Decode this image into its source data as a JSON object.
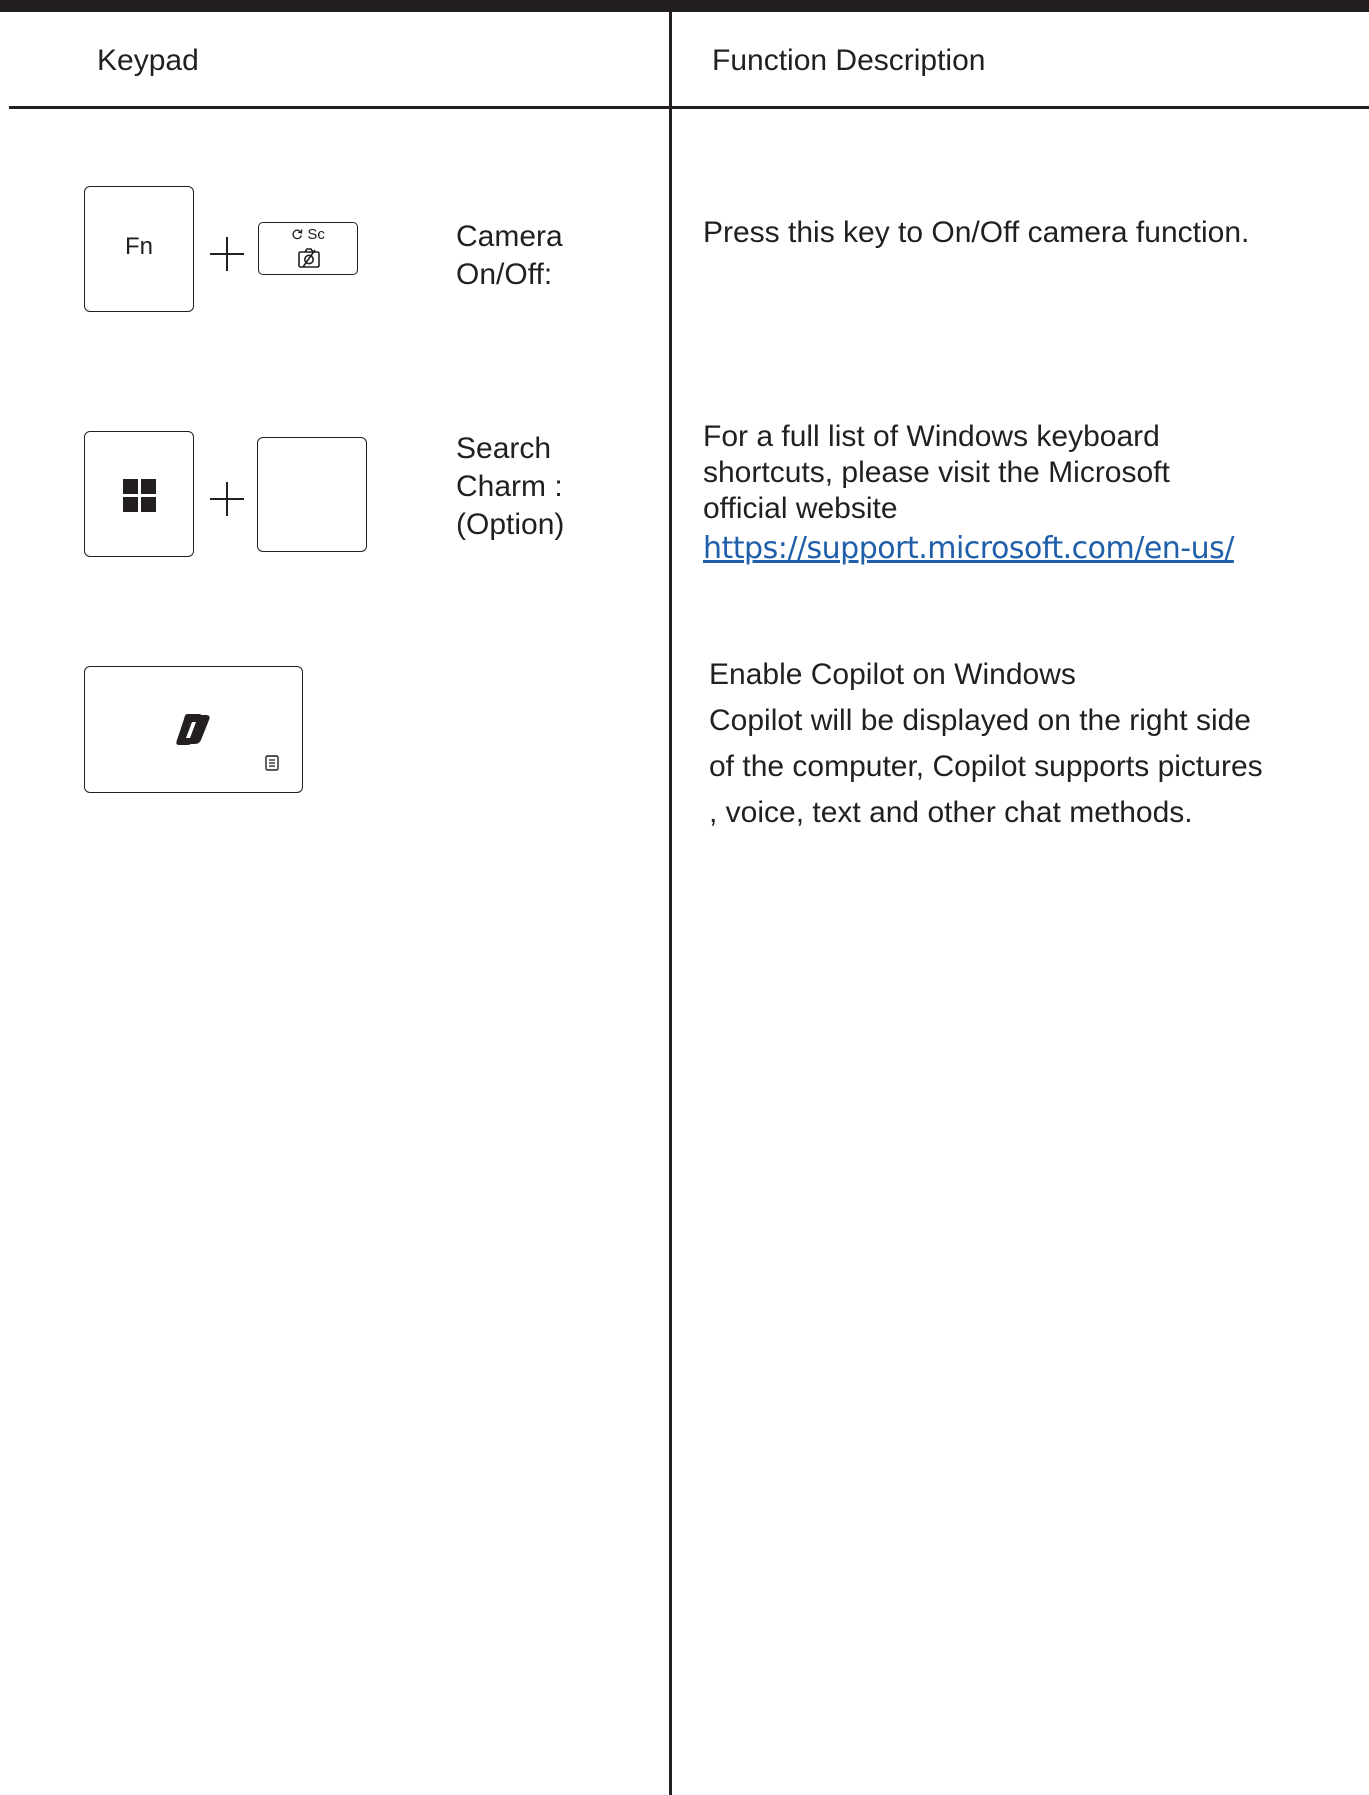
{
  "table": {
    "headers": {
      "keypad": "Keypad",
      "function_description": "Function Description"
    },
    "rows": [
      {
        "keys": [
          "Fn",
          "+",
          "Sc"
        ],
        "label_lines": [
          "Camera",
          "On/Off:"
        ],
        "description": "Press this key to On/Off camera function.",
        "icons": [
          "refresh-icon",
          "camera-off-icon"
        ]
      },
      {
        "keys": [
          "windows-logo-icon",
          "+",
          ""
        ],
        "label_lines": [
          "Search",
          "Charm :",
          "(Option)"
        ],
        "description_lines": [
          "For a full list of Windows keyboard",
          "shortcuts, please visit the Microsoft",
          "official website"
        ],
        "link": "https://support.microsoft.com/en-us/"
      },
      {
        "keys": [
          "copilot-icon"
        ],
        "key_icons": [
          "copilot-logo-icon",
          "menu-icon"
        ],
        "description_lines": [
          "Enable Copilot on Windows",
          "Copilot will be displayed on the right side",
          "of the computer, Copilot supports pictures",
          ", voice, text and other chat methods."
        ]
      }
    ]
  }
}
